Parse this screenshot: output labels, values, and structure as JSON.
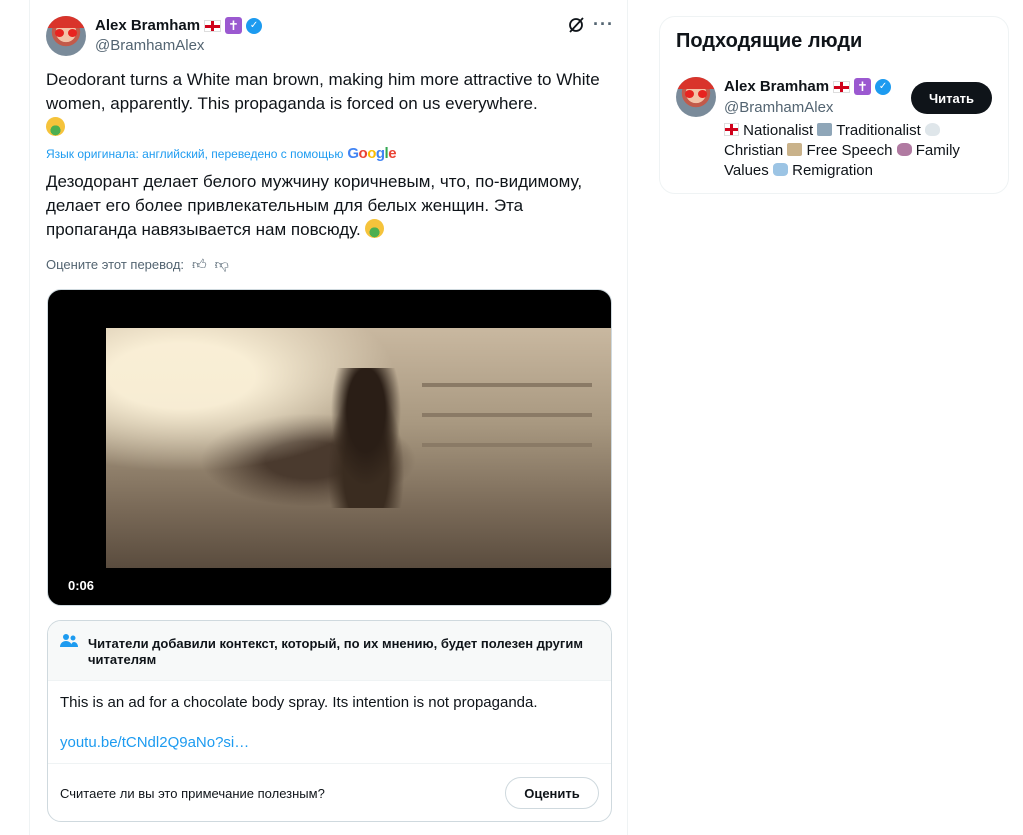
{
  "tweet": {
    "author_name": "Alex Bramham",
    "author_handle": "@BramhamAlex",
    "text_original": "Deodorant turns a White man brown, making him more attractive to White women, apparently. This propaganda is forced on us everywhere.",
    "translated_note": "Язык оригинала: английский, переведено с помощью",
    "translator_brand": "Google",
    "text_translated": "Дезодорант делает белого мужчину коричневым, что, по-видимому, делает его более привлекательным для белых женщин. Эта пропаганда навязывается нам повсюду.",
    "rate_translation_label": "Оцените этот перевод:",
    "video_time": "0:06"
  },
  "community_note": {
    "title": "Читатели добавили контекст, который, по их мнению, будет полезен другим читателям",
    "body": "This is an ad for a chocolate body spray. Its intention is not propaganda.",
    "link": "youtu.be/tCNdl2Q9aNo?si…",
    "question": "Считаете ли вы это примечание полезным?",
    "rate_button": "Оценить"
  },
  "sidebar": {
    "title": "Подходящие люди",
    "person": {
      "name": "Alex Bramham",
      "handle": "@BramhamAlex",
      "follow_label": "Читать",
      "bio_parts": [
        "Nationalist",
        "Traditionalist",
        "Christian",
        "Free Speech",
        "Family Values",
        "Remigration"
      ]
    }
  },
  "colors": {
    "accent": "#1d9bf0",
    "text": "#0f1419",
    "muted": "#536471",
    "border": "#cfd9de"
  },
  "icons": [
    "england-flag-icon",
    "latin-cross-icon",
    "verified-badge-icon",
    "grok-icon",
    "more-icon",
    "thumbs-up-icon",
    "thumbs-down-icon",
    "people-icon",
    "nauseated-face-icon"
  ]
}
